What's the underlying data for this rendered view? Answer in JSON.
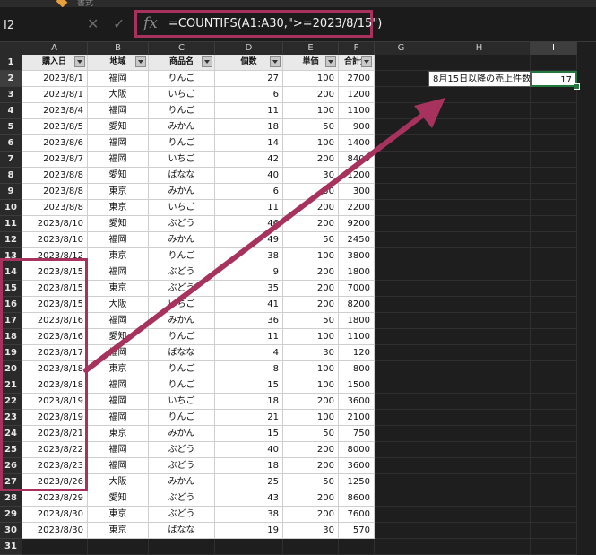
{
  "name_box": "I2",
  "formula_bar": {
    "fx_label": "fx",
    "cancel_icon": "✕",
    "enter_icon": "✓",
    "formula": "=COUNTIFS(A1:A30,\">=2023/8/15\")"
  },
  "toolbar_fragment": "書式",
  "columns": [
    "A",
    "B",
    "C",
    "D",
    "E",
    "F",
    "G",
    "H",
    "I"
  ],
  "row_numbers": [
    "1",
    "2",
    "3",
    "4",
    "5",
    "6",
    "7",
    "8",
    "9",
    "10",
    "11",
    "12",
    "13",
    "14",
    "15",
    "16",
    "17",
    "18",
    "19",
    "20",
    "21",
    "22",
    "23",
    "24",
    "25",
    "26",
    "27",
    "28",
    "29",
    "30",
    "31"
  ],
  "headers": [
    "購入日",
    "地域",
    "商品名",
    "個数",
    "単価",
    "合計金"
  ],
  "rows": [
    [
      "2023/8/1",
      "福岡",
      "りんご",
      "27",
      "100",
      "2700"
    ],
    [
      "2023/8/1",
      "大阪",
      "いちご",
      "6",
      "200",
      "1200"
    ],
    [
      "2023/8/4",
      "福岡",
      "りんご",
      "11",
      "100",
      "1100"
    ],
    [
      "2023/8/5",
      "愛知",
      "みかん",
      "18",
      "50",
      "900"
    ],
    [
      "2023/8/6",
      "福岡",
      "りんご",
      "14",
      "100",
      "1400"
    ],
    [
      "2023/8/7",
      "福岡",
      "いちご",
      "42",
      "200",
      "8400"
    ],
    [
      "2023/8/8",
      "愛知",
      "ばなな",
      "40",
      "30",
      "1200"
    ],
    [
      "2023/8/8",
      "東京",
      "みかん",
      "6",
      "50",
      "300"
    ],
    [
      "2023/8/8",
      "東京",
      "いちご",
      "11",
      "200",
      "2200"
    ],
    [
      "2023/8/10",
      "愛知",
      "ぶどう",
      "46",
      "200",
      "9200"
    ],
    [
      "2023/8/10",
      "福岡",
      "みかん",
      "49",
      "50",
      "2450"
    ],
    [
      "2023/8/12",
      "東京",
      "りんご",
      "38",
      "100",
      "3800"
    ],
    [
      "2023/8/15",
      "福岡",
      "ぶどう",
      "9",
      "200",
      "1800"
    ],
    [
      "2023/8/15",
      "東京",
      "ぶどう",
      "35",
      "200",
      "7000"
    ],
    [
      "2023/8/15",
      "大阪",
      "いちご",
      "41",
      "200",
      "8200"
    ],
    [
      "2023/8/16",
      "福岡",
      "みかん",
      "36",
      "50",
      "1800"
    ],
    [
      "2023/8/16",
      "愛知",
      "りんご",
      "11",
      "100",
      "1100"
    ],
    [
      "2023/8/17",
      "福岡",
      "ばなな",
      "4",
      "30",
      "120"
    ],
    [
      "2023/8/18",
      "東京",
      "りんご",
      "8",
      "100",
      "800"
    ],
    [
      "2023/8/18",
      "福岡",
      "りんご",
      "15",
      "100",
      "1500"
    ],
    [
      "2023/8/19",
      "福岡",
      "いちご",
      "18",
      "200",
      "3600"
    ],
    [
      "2023/8/19",
      "福岡",
      "りんご",
      "21",
      "100",
      "2100"
    ],
    [
      "2023/8/21",
      "東京",
      "みかん",
      "15",
      "50",
      "750"
    ],
    [
      "2023/8/22",
      "福岡",
      "ぶどう",
      "40",
      "200",
      "8000"
    ],
    [
      "2023/8/23",
      "福岡",
      "ぶどう",
      "18",
      "200",
      "3600"
    ],
    [
      "2023/8/26",
      "大阪",
      "みかん",
      "25",
      "50",
      "1250"
    ],
    [
      "2023/8/29",
      "愛知",
      "ぶどう",
      "43",
      "200",
      "8600"
    ],
    [
      "2023/8/30",
      "東京",
      "ぶどう",
      "38",
      "200",
      "7600"
    ],
    [
      "2023/8/30",
      "東京",
      "ばなな",
      "19",
      "30",
      "570"
    ]
  ],
  "result_label": "8月15日以降の売上件数：",
  "result_value": "17",
  "colors": {
    "highlight": "#a8325e",
    "selection": "#1f7a3c"
  }
}
